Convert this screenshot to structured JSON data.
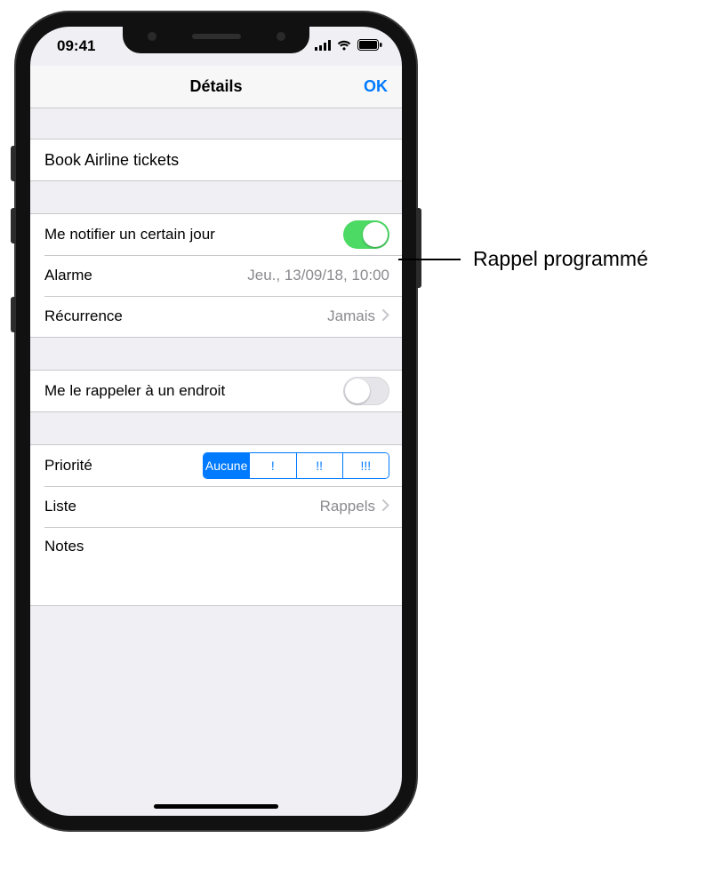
{
  "status": {
    "time": "09:41"
  },
  "nav": {
    "title": "Détails",
    "done": "OK"
  },
  "reminder": {
    "title": "Book Airline tickets"
  },
  "day": {
    "label": "Me notifier un certain jour",
    "on": true
  },
  "alarm": {
    "label": "Alarme",
    "value": "Jeu., 13/09/18, 10:00"
  },
  "repeat": {
    "label": "Récurrence",
    "value": "Jamais"
  },
  "location": {
    "label": "Me le rappeler à un endroit",
    "on": false
  },
  "priority": {
    "label": "Priorité",
    "options": [
      "Aucune",
      "!",
      "!!",
      "!!!"
    ],
    "selected_index": 0
  },
  "list": {
    "label": "Liste",
    "value": "Rappels"
  },
  "notes": {
    "label": "Notes"
  },
  "callout": {
    "text": "Rappel programmé"
  }
}
